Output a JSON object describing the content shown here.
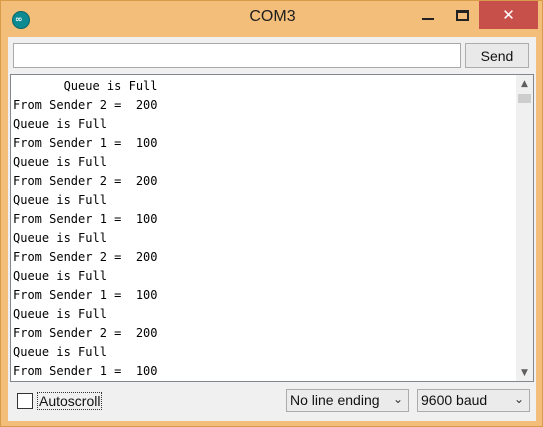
{
  "window": {
    "title": "COM3",
    "app_icon": "arduino-icon",
    "app_icon_left": "∞",
    "minimize_icon": "minimize-icon",
    "maximize_icon": "maximize-icon",
    "close_icon": "close-icon",
    "close_glyph": "✕"
  },
  "input": {
    "value": "",
    "send_label": "Send"
  },
  "output": {
    "lines": [
      "       Queue is Full",
      "From Sender 2 =  200",
      "Queue is Full",
      "From Sender 1 =  100",
      "Queue is Full",
      "From Sender 2 =  200",
      "Queue is Full",
      "From Sender 1 =  100",
      "Queue is Full",
      "From Sender 2 =  200",
      "Queue is Full",
      "From Sender 1 =  100",
      "Queue is Full",
      "From Sender 2 =  200",
      "Queue is Full",
      "From Sender 1 =  100"
    ],
    "scroll_up_icon": "▲",
    "scroll_down_icon": "▼"
  },
  "footer": {
    "autoscroll_label": "Autoscroll",
    "autoscroll_checked": false,
    "line_ending": "No line ending",
    "baud": "9600 baud",
    "dropdown_glyph": "⌄"
  },
  "colors": {
    "titlebar": "#f2be7a",
    "close_button": "#c7504a",
    "app_icon": "#0c8a92"
  }
}
